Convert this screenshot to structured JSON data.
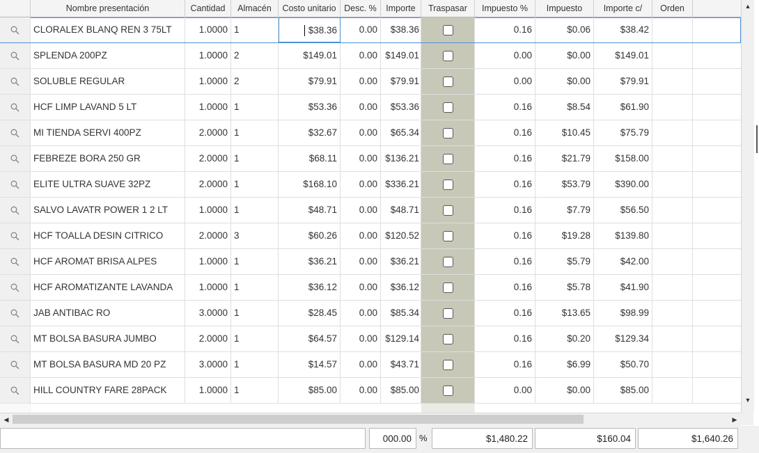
{
  "columns": [
    "Nombre presentación",
    "Cantidad",
    "Almacén",
    "Costo unitario",
    "Desc. %",
    "Importe",
    "Traspasar",
    "Impuesto %",
    "Impuesto",
    "Importe c/",
    "Orden"
  ],
  "rows": [
    {
      "nombre": "CLORALEX BLANQ REN 3 75LT",
      "cantidad": "1.0000",
      "almacen": "1",
      "costo": "$38.36",
      "desc": "0.00",
      "importe": "$38.36",
      "imp_pct": "0.16",
      "impuesto": "$0.06",
      "importe_c": "$38.42"
    },
    {
      "nombre": "SPLENDA 200PZ",
      "cantidad": "1.0000",
      "almacen": "2",
      "costo": "$149.01",
      "desc": "0.00",
      "importe": "$149.01",
      "imp_pct": "0.00",
      "impuesto": "$0.00",
      "importe_c": "$149.01"
    },
    {
      "nombre": "SOLUBLE REGULAR",
      "cantidad": "1.0000",
      "almacen": "2",
      "costo": "$79.91",
      "desc": "0.00",
      "importe": "$79.91",
      "imp_pct": "0.00",
      "impuesto": "$0.00",
      "importe_c": "$79.91"
    },
    {
      "nombre": "HCF LIMP LAVAND 5 LT",
      "cantidad": "1.0000",
      "almacen": "1",
      "costo": "$53.36",
      "desc": "0.00",
      "importe": "$53.36",
      "imp_pct": "0.16",
      "impuesto": "$8.54",
      "importe_c": "$61.90"
    },
    {
      "nombre": "MI TIENDA SERVI 400PZ",
      "cantidad": "2.0000",
      "almacen": "1",
      "costo": "$32.67",
      "desc": "0.00",
      "importe": "$65.34",
      "imp_pct": "0.16",
      "impuesto": "$10.45",
      "importe_c": "$75.79"
    },
    {
      "nombre": "FEBREZE BORA 250 GR",
      "cantidad": "2.0000",
      "almacen": "1",
      "costo": "$68.11",
      "desc": "0.00",
      "importe": "$136.21",
      "imp_pct": "0.16",
      "impuesto": "$21.79",
      "importe_c": "$158.00"
    },
    {
      "nombre": "ELITE ULTRA SUAVE 32PZ",
      "cantidad": "2.0000",
      "almacen": "1",
      "costo": "$168.10",
      "desc": "0.00",
      "importe": "$336.21",
      "imp_pct": "0.16",
      "impuesto": "$53.79",
      "importe_c": "$390.00"
    },
    {
      "nombre": "SALVO LAVATR POWER 1 2 LT",
      "cantidad": "1.0000",
      "almacen": "1",
      "costo": "$48.71",
      "desc": "0.00",
      "importe": "$48.71",
      "imp_pct": "0.16",
      "impuesto": "$7.79",
      "importe_c": "$56.50"
    },
    {
      "nombre": "HCF TOALLA DESIN CITRICO",
      "cantidad": "2.0000",
      "almacen": "3",
      "costo": "$60.26",
      "desc": "0.00",
      "importe": "$120.52",
      "imp_pct": "0.16",
      "impuesto": "$19.28",
      "importe_c": "$139.80"
    },
    {
      "nombre": "HCF AROMAT BRISA ALPES",
      "cantidad": "1.0000",
      "almacen": "1",
      "costo": "$36.21",
      "desc": "0.00",
      "importe": "$36.21",
      "imp_pct": "0.16",
      "impuesto": "$5.79",
      "importe_c": "$42.00"
    },
    {
      "nombre": "HCF AROMATIZANTE LAVANDA",
      "cantidad": "1.0000",
      "almacen": "1",
      "costo": "$36.12",
      "desc": "0.00",
      "importe": "$36.12",
      "imp_pct": "0.16",
      "impuesto": "$5.78",
      "importe_c": "$41.90"
    },
    {
      "nombre": "JAB ANTIBAC RO",
      "cantidad": "3.0000",
      "almacen": "1",
      "costo": "$28.45",
      "desc": "0.00",
      "importe": "$85.34",
      "imp_pct": "0.16",
      "impuesto": "$13.65",
      "importe_c": "$98.99"
    },
    {
      "nombre": "MT BOLSA BASURA JUMBO",
      "cantidad": "2.0000",
      "almacen": "1",
      "costo": "$64.57",
      "desc": "0.00",
      "importe": "$129.14",
      "imp_pct": "0.16",
      "impuesto": "$0.20",
      "importe_c": "$129.34"
    },
    {
      "nombre": "MT BOLSA BASURA MD 20 PZ",
      "cantidad": "3.0000",
      "almacen": "1",
      "costo": "$14.57",
      "desc": "0.00",
      "importe": "$43.71",
      "imp_pct": "0.16",
      "impuesto": "$6.99",
      "importe_c": "$50.70"
    },
    {
      "nombre": "HILL COUNTRY FARE 28PACK",
      "cantidad": "1.0000",
      "almacen": "1",
      "costo": "$85.00",
      "desc": "0.00",
      "importe": "$85.00",
      "imp_pct": "0.00",
      "impuesto": "$0.00",
      "importe_c": "$85.00"
    }
  ],
  "footer": {
    "desc_total": "000.00",
    "pct_symbol": "%",
    "importe_total": "$1,480.22",
    "impuesto_total": "$160.04",
    "importe_c_total": "$1,640.26"
  },
  "colors": {
    "traspasar_bg": "#c8c8b8",
    "selection_border": "#4a90d9",
    "header_bg": "#f4f4f4"
  },
  "icons": {
    "row_selector": "search-icon",
    "scroll_up": "arrow-up-icon",
    "scroll_down": "arrow-down-icon",
    "scroll_left": "arrow-left-icon",
    "scroll_right": "arrow-right-icon"
  }
}
